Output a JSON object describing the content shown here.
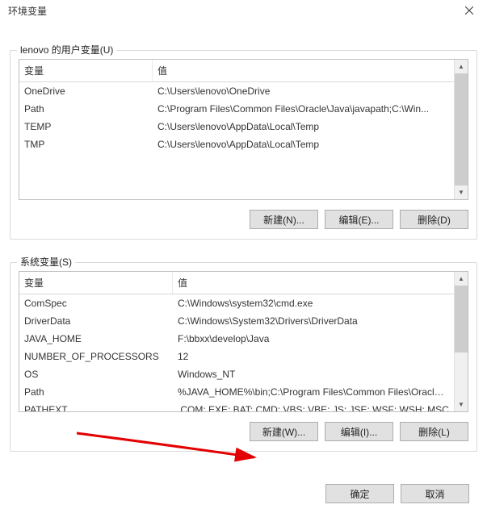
{
  "title": "环境变量",
  "userVars": {
    "label": "lenovo 的用户变量(U)",
    "headers": {
      "name": "变量",
      "value": "值"
    },
    "rows": [
      {
        "name": "OneDrive",
        "value": "C:\\Users\\lenovo\\OneDrive"
      },
      {
        "name": "Path",
        "value": "C:\\Program Files\\Common Files\\Oracle\\Java\\javapath;C:\\Win..."
      },
      {
        "name": "TEMP",
        "value": "C:\\Users\\lenovo\\AppData\\Local\\Temp"
      },
      {
        "name": "TMP",
        "value": "C:\\Users\\lenovo\\AppData\\Local\\Temp"
      }
    ],
    "buttons": {
      "new": "新建(N)...",
      "edit": "编辑(E)...",
      "delete": "删除(D)"
    }
  },
  "systemVars": {
    "label": "系统变量(S)",
    "headers": {
      "name": "变量",
      "value": "值"
    },
    "rows": [
      {
        "name": "ComSpec",
        "value": "C:\\Windows\\system32\\cmd.exe"
      },
      {
        "name": "DriverData",
        "value": "C:\\Windows\\System32\\Drivers\\DriverData"
      },
      {
        "name": "JAVA_HOME",
        "value": "F:\\bbxx\\develop\\Java"
      },
      {
        "name": "NUMBER_OF_PROCESSORS",
        "value": "12"
      },
      {
        "name": "OS",
        "value": "Windows_NT"
      },
      {
        "name": "Path",
        "value": "%JAVA_HOME%\\bin;C:\\Program Files\\Common Files\\Oracle\\J..."
      },
      {
        "name": "PATHEXT",
        "value": ".COM;.EXE;.BAT;.CMD;.VBS;.VBE;.JS;.JSE;.WSF;.WSH;.MSC"
      }
    ],
    "buttons": {
      "new": "新建(W)...",
      "edit": "编辑(I)...",
      "delete": "删除(L)"
    }
  },
  "footer": {
    "ok": "确定",
    "cancel": "取消"
  }
}
